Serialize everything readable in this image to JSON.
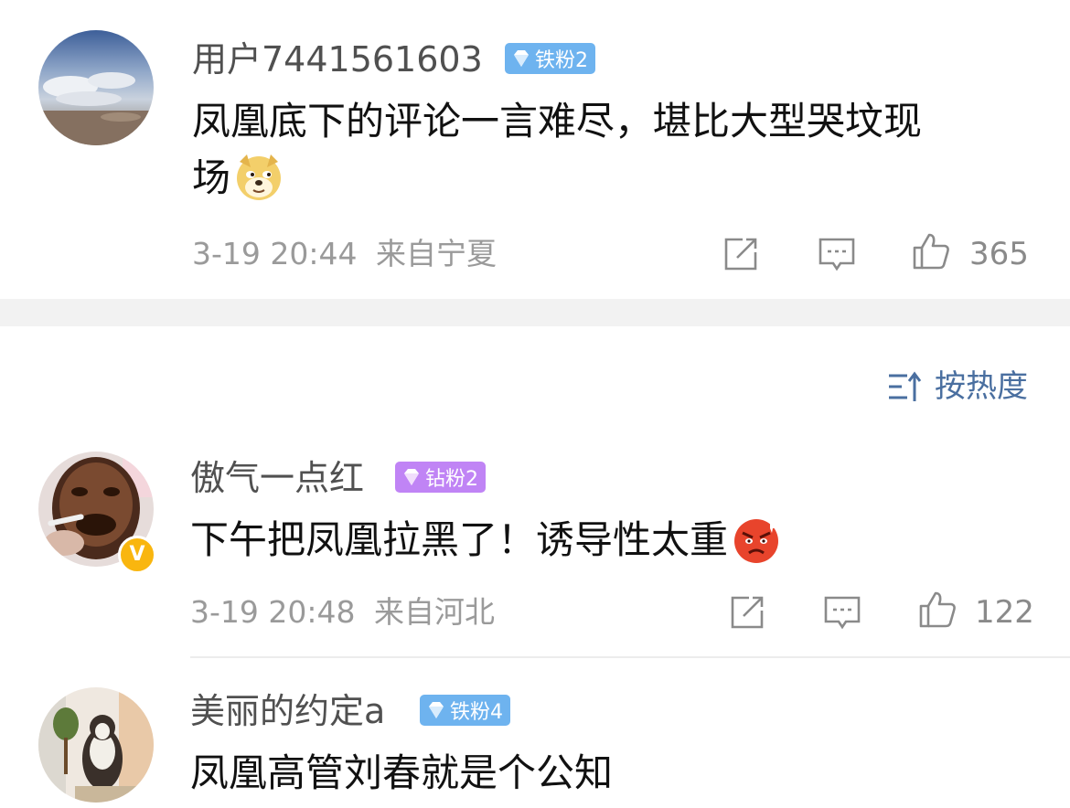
{
  "comments": [
    {
      "username": "用户7441561603",
      "badge": {
        "type": "iron",
        "label": "铁粉2",
        "color": "#6eb3ef"
      },
      "text": "凤凰底下的评论一言难尽，堪比大型哭坟现",
      "text_line2": "场",
      "emoji": "doge-emoji",
      "time": "3-19 20:44",
      "location": "来自宁夏",
      "likes": "365"
    },
    {
      "username": "傲气一点红",
      "badge": {
        "type": "diamond",
        "label": "钻粉2",
        "color": "#c084f5"
      },
      "verified": "V",
      "text": "下午把凤凰拉黑了！诱导性太重",
      "emoji": "angry-emoji",
      "time": "3-19 20:48",
      "location": "来自河北",
      "likes": "122"
    },
    {
      "username": "美丽的约定a",
      "badge": {
        "type": "iron",
        "label": "铁粉4",
        "color": "#6eb3ef"
      },
      "text": "凤凰高管刘春就是个公知"
    }
  ],
  "sort": {
    "label": "按热度",
    "icon": "sort-icon"
  },
  "colors": {
    "meta": "#9a9a9a",
    "link": "#4a6fa0",
    "section_gap": "#f2f2f2"
  }
}
